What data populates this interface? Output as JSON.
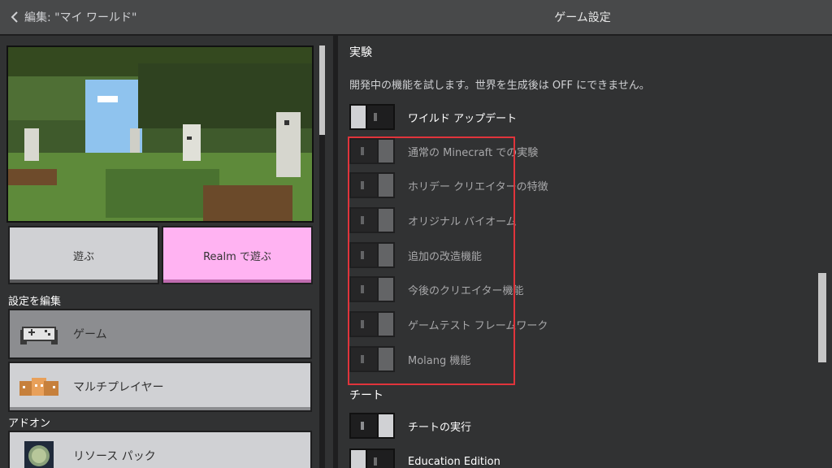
{
  "header": {
    "back_label": "編集: \"マイ ワールド\"",
    "title": "ゲーム設定"
  },
  "left": {
    "play_button": "遊ぶ",
    "realm_button": "Realm で遊ぶ",
    "edit_settings_label": "設定を編集",
    "menu_game": "ゲーム",
    "menu_multiplayer": "マルチプレイヤー",
    "addons_label": "アドオン",
    "menu_resource_packs": "リソース パック"
  },
  "right": {
    "experiments_heading": "実験",
    "experiments_desc": "開発中の機能を試します。世界を生成後は OFF にできません。",
    "toggles": [
      {
        "label": "ワイルド アップデート",
        "state": "off",
        "enabled": true
      },
      {
        "label": "通常の Minecraft での実験",
        "state": "on",
        "enabled": false
      },
      {
        "label": "ホリデー クリエイターの特徴",
        "state": "on",
        "enabled": false
      },
      {
        "label": "オリジナル バイオーム",
        "state": "on",
        "enabled": false
      },
      {
        "label": "追加の改造機能",
        "state": "on",
        "enabled": false
      },
      {
        "label": "今後のクリエイター機能",
        "state": "on",
        "enabled": false
      },
      {
        "label": "ゲームテスト フレームワーク",
        "state": "on",
        "enabled": false
      },
      {
        "label": "Molang 機能",
        "state": "on",
        "enabled": false
      }
    ],
    "cheats_heading": "チート",
    "cheat_toggles": [
      {
        "label": "チートの実行",
        "state": "on",
        "enabled": true
      },
      {
        "label": "Education Edition",
        "state": "off",
        "enabled": true
      }
    ]
  },
  "colors": {
    "background": "#313233",
    "button_gray": "#d0d1d4",
    "realm_pink": "#ffb3f2",
    "highlight_red": "#e0343b"
  }
}
